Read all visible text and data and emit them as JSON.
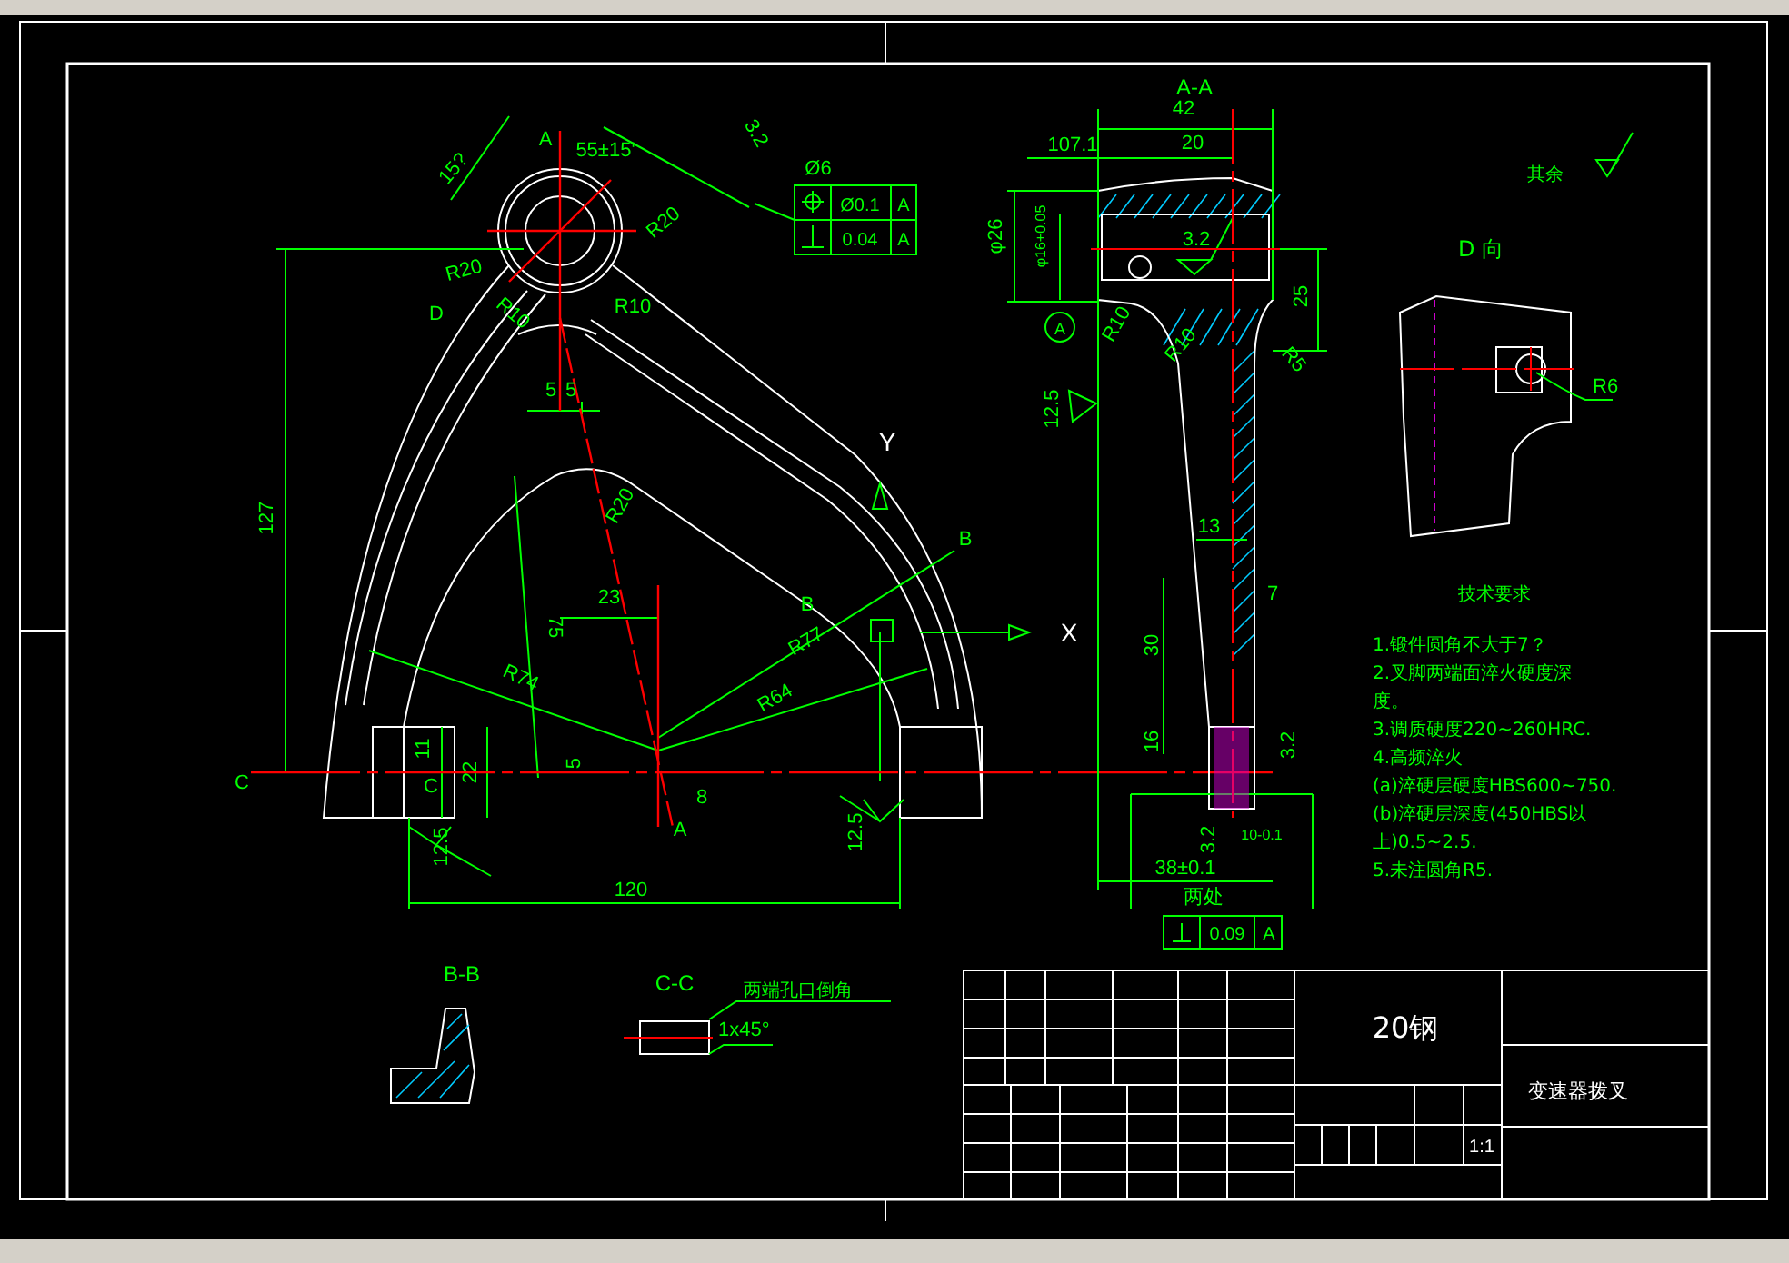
{
  "main_view": {
    "labels": [
      "A",
      "55±15'",
      "15?",
      "R20",
      "3.2",
      "R20",
      "R10",
      "D",
      "R10",
      "5",
      "5",
      "R20",
      "127",
      "75",
      "23",
      "R74",
      "R77",
      "R64",
      "B",
      "B",
      "C",
      "C",
      "11",
      "22",
      "5",
      "8",
      "A",
      "12.5",
      "12.5",
      "120",
      "Ø6"
    ],
    "axes": [
      "Y",
      "X"
    ]
  },
  "tolerance_frame": {
    "rows": [
      {
        "kind": "position",
        "value": "Ø0.1",
        "datum": "A"
      },
      {
        "kind": "perpendicular",
        "value": "0.04",
        "datum": "A"
      }
    ]
  },
  "section_aa": {
    "title": "A-A",
    "labels": [
      "42",
      "107.1",
      "20",
      "φ26",
      "φ16+0.05",
      "3.2",
      "25",
      "R10",
      "R10",
      "R5",
      "12.5",
      "13",
      "7",
      "30",
      "16",
      "3.2",
      "3.2",
      "10-0.1",
      "38±0.1",
      "两处"
    ],
    "datum": "A",
    "frame": {
      "kind": "perpendicular",
      "value": "0.09",
      "datum": "A"
    }
  },
  "roughness_note": {
    "label": "其余"
  },
  "view_d": {
    "title": "D 向",
    "radius": "R6"
  },
  "tech_requirements": {
    "title": "技术要求",
    "lines": [
      "1.锻件圆角不大于7？",
      "2.叉脚两端面淬火硬度深",
      "度。",
      "3.调质硬度220~260HRC.",
      "4.高频淬火",
      "(a)淬硬层硬度HBS600~750.",
      "(b)淬硬层深度(450HBS以",
      "上)0.5~2.5.",
      "5.未注圆角R5."
    ]
  },
  "section_bb": {
    "title": "B-B"
  },
  "section_cc": {
    "title": "C-C",
    "note": "两端孔口倒角",
    "chamfer": "1x45°"
  },
  "title_block": {
    "material": "20钢",
    "part_name": "变速器拨叉",
    "scale": "1:1"
  }
}
